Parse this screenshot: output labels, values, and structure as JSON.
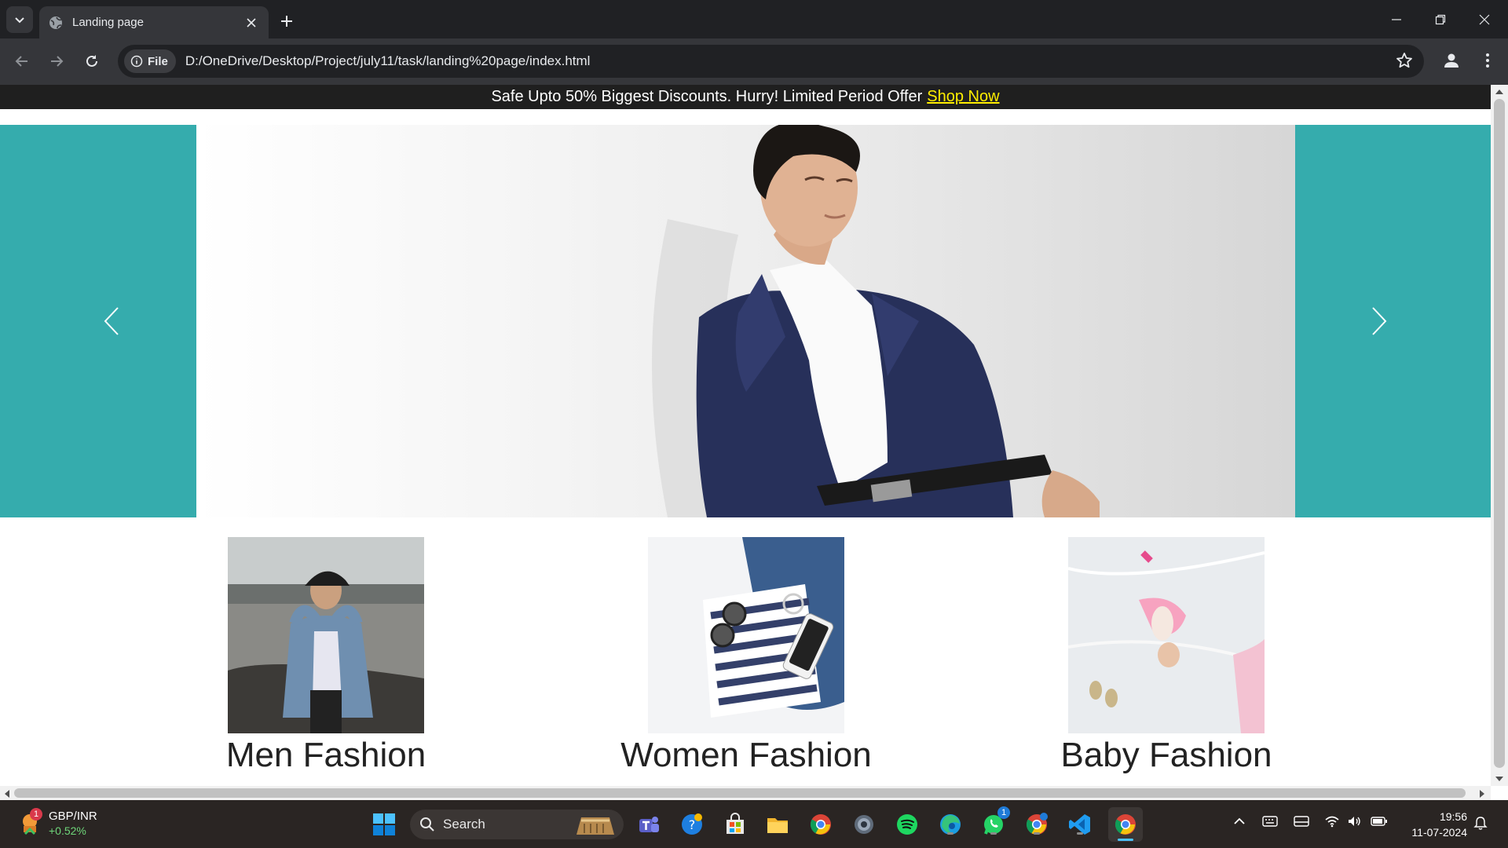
{
  "browser": {
    "tab_title": "Landing page",
    "security_chip": "File",
    "url": "D:/OneDrive/Desktop/Project/july11/task/landing%20page/index.html"
  },
  "page": {
    "promo_text": "Safe Upto 50% Biggest Discounts. Hurry! Limited Period Offer",
    "promo_link": "Shop Now",
    "categories": [
      {
        "label": "Men Fashion"
      },
      {
        "label": "Women Fashion"
      },
      {
        "label": "Baby Fashion"
      }
    ],
    "colors": {
      "banner": "#1f1f1f",
      "carousel": "#35acad",
      "link": "#ffee00"
    }
  },
  "taskbar": {
    "ticker_symbol": "GBP/INR",
    "ticker_change": "+0.52%",
    "ticker_badge": "1",
    "search_label": "Search",
    "whatsapp_badge": "1",
    "time": "19:56",
    "date": "11-07-2024"
  }
}
